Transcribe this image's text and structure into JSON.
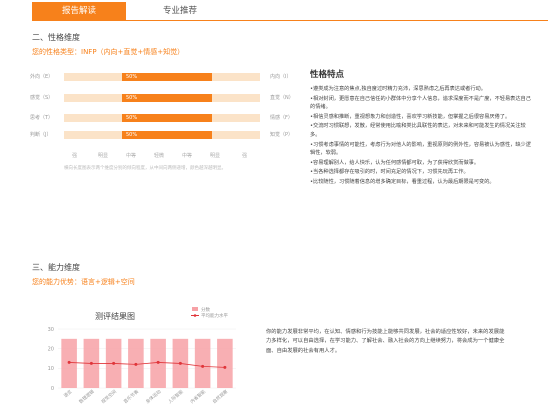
{
  "tabs": [
    {
      "label": "报告解读",
      "active": true
    },
    {
      "label": "专业推荐",
      "active": false
    }
  ],
  "personality": {
    "section_title": "二、性格维度",
    "type_line": "您的性格类型：INFP（内向+直觉+情感+知觉）",
    "rows": [
      {
        "left": "外向（E）",
        "right": "内向（I）",
        "percent_label": "50%",
        "fill_pct": 50
      },
      {
        "left": "感觉（S）",
        "right": "直觉（N）",
        "percent_label": "50%",
        "fill_pct": 50
      },
      {
        "left": "思考（T）",
        "right": "情感（F）",
        "percent_label": "50%",
        "fill_pct": 50
      },
      {
        "left": "判断（J）",
        "right": "知觉（P）",
        "percent_label": "50%",
        "fill_pct": 50
      }
    ],
    "scale": [
      "强",
      "明显",
      "中等",
      "轻微",
      "中等",
      "明显",
      "强"
    ],
    "note": "横向长度图表示两个维度分别的倾向程度，从中间向两侧递增，颜色越深越明显。"
  },
  "traits": {
    "title": "性格特点",
    "items": [
      "•遵类成为注意的焦点,独自度过时精力充沛，深思熟虑之后再表达或者行动。",
      "•相对封闭，更愿意在自己信任的小群体中分享个人信息，追求深度而不是广度，不轻易表达自己的情绪。",
      "•相信灵感和推断，重视想象力和创造性，喜欢学习新技能，但掌握之后很容易厌倦了。",
      "•交流时习惯联想，发散，经常使用比喻和类比具联性的表达，对未来和可能发生的情况关注较多。",
      "•习惯考虑事情的可能性，考虑行为对他人的影响，重视原则的例外性，容易被认为感性，缺少逻辑性，软弱。",
      "•容易理解别人，给人快乐，认为任何感情都可取，为了获得欣赏而做事。",
      "•当各种选择都存在吸引的时，时间充足的情况下，习惯先玩再工作。",
      "•比较随性，习惯随着信息的增多确定目标，看重过程，认为最后期限是可变的。"
    ]
  },
  "ability": {
    "section_title": "三、能力维度",
    "advantage": "您的能力优势：语言+逻辑+空间",
    "description": "你的能力发展非常平均，在认知、情感和行为技能上能够共同发展，社会的适应性较好，未来的发展能力多样化，可以自由选择，在学习能力、了解社会、融入社会的方向上继续努力，将会成为一个健康全面、自由发展的社会有用人才。"
  },
  "chart_data": {
    "type": "bar",
    "title": "测评结果图",
    "categories": [
      "语言",
      "数理逻辑",
      "视觉空间",
      "音乐节奏",
      "身体运动",
      "人际智能",
      "内省智能",
      "自然观察"
    ],
    "series": [
      {
        "name": "分数",
        "type": "bar",
        "color": "#f7a1a6",
        "values": [
          25,
          25,
          25,
          25,
          25,
          25,
          25,
          25
        ]
      },
      {
        "name": "平均能力水平",
        "type": "line",
        "color": "#e0353a",
        "values": [
          13,
          12.5,
          12.5,
          12,
          13,
          12.5,
          11,
          10.5
        ]
      }
    ],
    "ylim": [
      0,
      30
    ],
    "yticks": [
      0,
      10,
      20,
      30
    ],
    "ytick_labels": [
      "0",
      "10",
      "20",
      "30"
    ],
    "legend_position": "top-right"
  }
}
